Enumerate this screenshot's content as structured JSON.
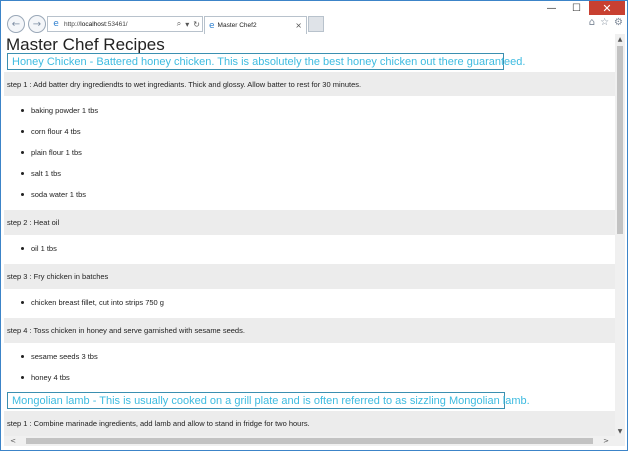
{
  "browser": {
    "caption": {
      "minimize": "—",
      "maximize": "☐",
      "close": "✕"
    },
    "address_prefix": "http://",
    "address_host": "localhost",
    "address_suffix": ":53461/",
    "search_icon": "⌕",
    "dropdown_icon": "▾",
    "refresh_icon": "↻",
    "tab_title": "Master Chef2",
    "tab_close": "×",
    "back_icon": "←",
    "forward_icon": "→",
    "home_icon": "⌂",
    "favorites_icon": "☆",
    "settings_icon": "⚙",
    "accent_color": "#2d7fcf",
    "close_color": "#c84031"
  },
  "page": {
    "title": "Master Chef Recipes",
    "recipes": [
      {
        "heading": "Honey Chicken - Battered honey chicken. This is absolutely the best honey chicken out there guaranteed.",
        "steps": [
          {
            "text": "step 1 : Add batter dry ingrediendts to wet ingrediants. Thick and glossy. Allow batter to rest for 30 minutes.",
            "ingredients": [
              "baking powder 1 tbs",
              "corn flour 4 tbs",
              "plain flour 1 tbs",
              "salt 1 tbs",
              "soda water 1 tbs"
            ]
          },
          {
            "text": "step 2 : Heat oil",
            "ingredients": [
              "oil 1 tbs"
            ]
          },
          {
            "text": "step 3 : Fry chicken in batches",
            "ingredients": [
              "chicken breast fillet, cut into strips 750 g"
            ]
          },
          {
            "text": "step 4 : Toss chicken in honey and serve garnished with sesame seeds.",
            "ingredients": [
              "sesame seeds 3 tbs",
              "honey 4 tbs"
            ]
          }
        ]
      },
      {
        "heading": "Mongolian lamb - This is usually cooked on a grill plate and is often referred to as sizzling Mongolian lamb.",
        "steps": [
          {
            "text": "step 1 : Combine marinade ingredients, add lamb and allow to stand in fridge for two hours.",
            "ingredients": []
          }
        ]
      }
    ],
    "heading_color": "#3dbbe0",
    "heading_border_color": "#3b8fb0",
    "step_background": "#ececec"
  },
  "scrollbars": {
    "up": "▲",
    "down": "▼",
    "left": "<",
    "right": ">"
  }
}
